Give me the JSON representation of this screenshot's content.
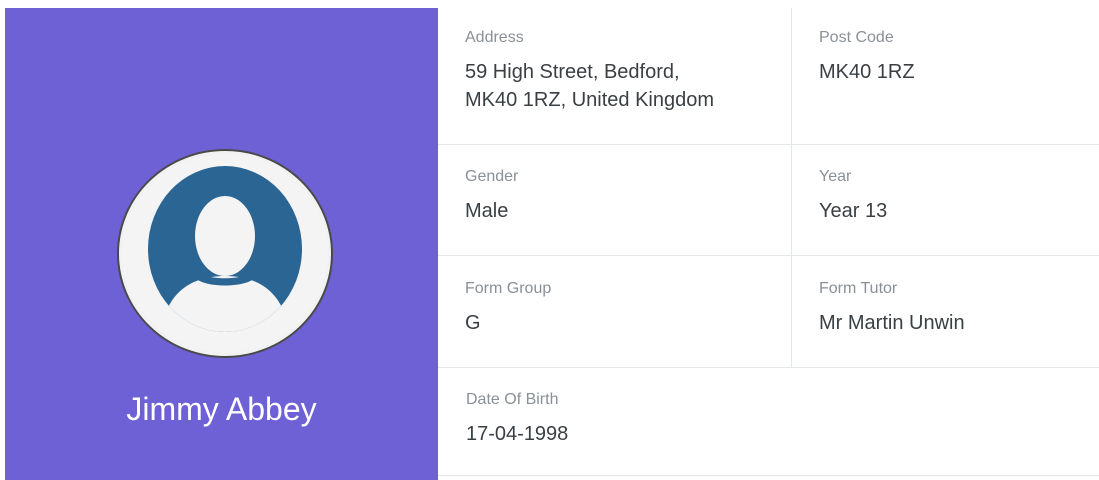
{
  "profile": {
    "name": "Jimmy Abbey",
    "avatar_icon": "user-avatar-icon",
    "panel_color": "#6e61d6",
    "avatar_color": "#2b6593"
  },
  "details": {
    "address": {
      "label": "Address",
      "value": "59 High Street, Bedford,\nMK40 1RZ, United Kingdom"
    },
    "post_code": {
      "label": "Post Code",
      "value": "MK40 1RZ"
    },
    "gender": {
      "label": "Gender",
      "value": "Male"
    },
    "year": {
      "label": "Year",
      "value": "Year 13"
    },
    "form_group": {
      "label": "Form Group",
      "value": "G"
    },
    "form_tutor": {
      "label": "Form Tutor",
      "value": "Mr Martin Unwin"
    },
    "date_of_birth": {
      "label": "Date Of Birth",
      "value": "17-04-1998"
    }
  }
}
